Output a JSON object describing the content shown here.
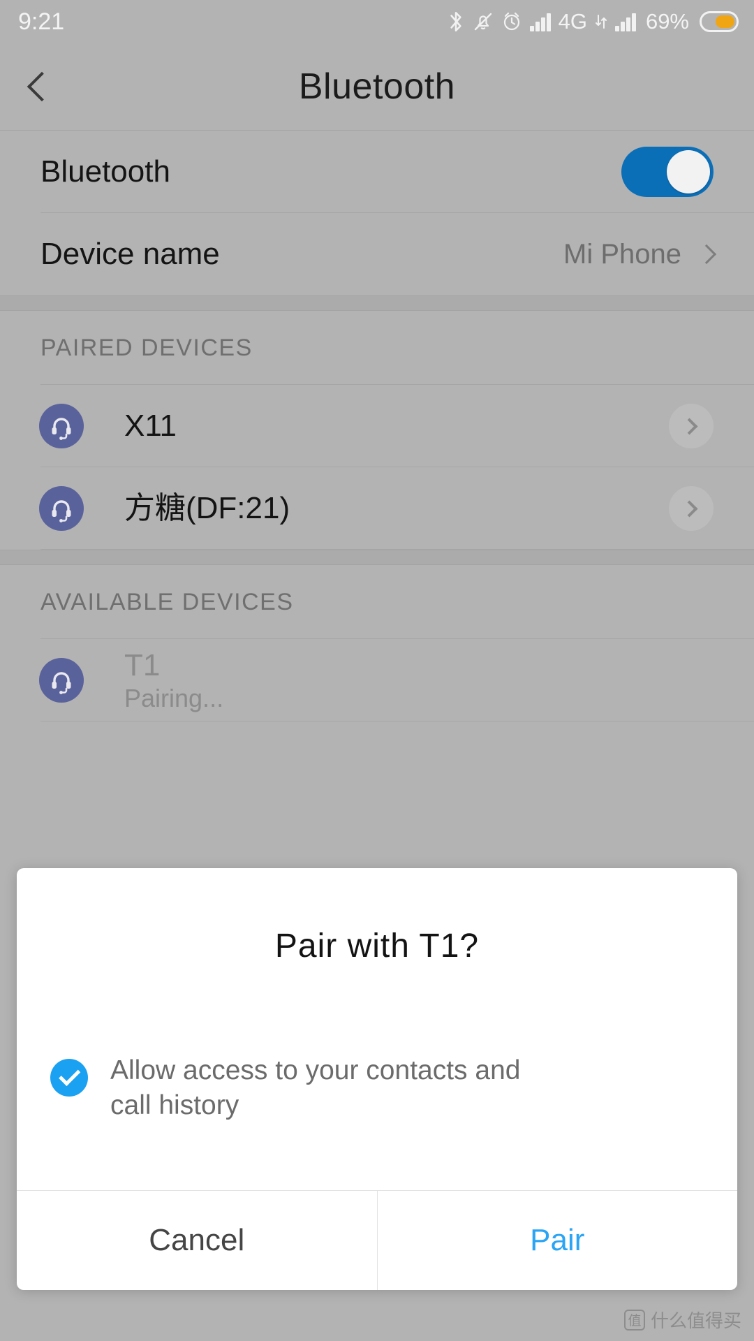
{
  "status_bar": {
    "time": "9:21",
    "battery_percent": "69%",
    "network_label": "4G",
    "icons": [
      "bluetooth-icon",
      "silent-mode-icon",
      "alarm-icon",
      "signal-bars-icon",
      "data-transfer-icon",
      "signal-bars-icon",
      "battery-icon"
    ],
    "colors": {
      "battery_fill": "#f0a614",
      "text": "#f4f4f4"
    }
  },
  "app_bar": {
    "title": "Bluetooth",
    "back_label": "Back"
  },
  "settings": {
    "bluetooth_row": {
      "label": "Bluetooth",
      "toggle_on": true,
      "toggle_color": "#0b6fb8"
    },
    "device_name_row": {
      "label": "Device name",
      "value": "Mi Phone"
    }
  },
  "paired_section": {
    "header": "PAIRED DEVICES",
    "devices": [
      {
        "name": "X11",
        "subtitle": "",
        "icon": "headset-icon",
        "muted": false
      },
      {
        "name": "方糖(DF:21)",
        "subtitle": "",
        "icon": "headset-icon",
        "muted": false
      }
    ]
  },
  "available_section": {
    "header": "AVAILABLE DEVICES",
    "devices": [
      {
        "name": "T1",
        "subtitle": "Pairing...",
        "icon": "headset-icon",
        "muted": true
      }
    ]
  },
  "dialog": {
    "title": "Pair  with  T1?",
    "checkbox_checked": true,
    "checkbox_label": "Allow access to your contacts and call history",
    "cancel_label": "Cancel",
    "confirm_label": "Pair",
    "accent_color": "#2aa4f4",
    "check_color": "#1ba1f2"
  },
  "watermark": {
    "logo_glyph": "值",
    "text": "什么值得买"
  }
}
